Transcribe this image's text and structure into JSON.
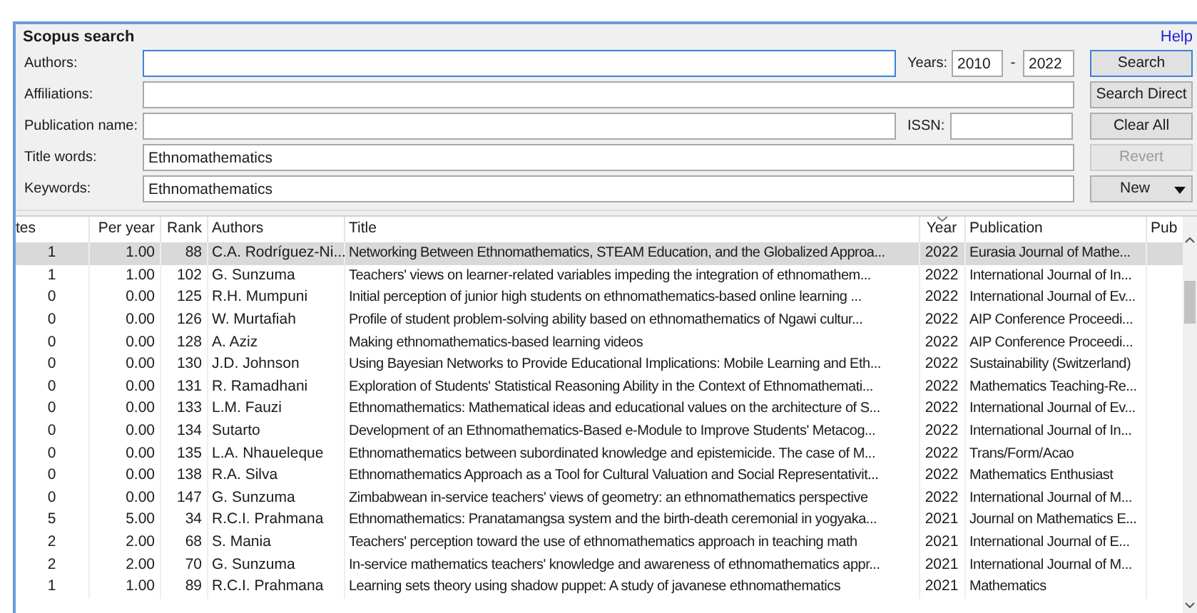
{
  "panel": {
    "title": "Scopus search",
    "help_link": "Help"
  },
  "form": {
    "authors": {
      "label": "Authors:",
      "focused": true
    },
    "years": {
      "label": "Years:",
      "from": "2010",
      "separator": "-",
      "to": "2022"
    },
    "affiliations": {
      "label": "Affiliations:"
    },
    "publication_name": {
      "label": "Publication name:"
    },
    "issn": {
      "label": "ISSN:"
    },
    "title_words": {
      "label": "Title words:",
      "value": "Ethnomathematics"
    },
    "keywords": {
      "label": "Keywords:",
      "value": "Ethnomathematics"
    }
  },
  "buttons": [
    {
      "label": "Search",
      "default": true,
      "disabled": false,
      "dropdown": false
    },
    {
      "label": "Search Direct",
      "default": false,
      "disabled": false,
      "dropdown": false
    },
    {
      "label": "Clear All",
      "default": false,
      "disabled": false,
      "dropdown": false
    },
    {
      "label": "Revert",
      "default": false,
      "disabled": true,
      "dropdown": false
    },
    {
      "label": "New",
      "default": false,
      "disabled": false,
      "dropdown": true
    }
  ],
  "table": {
    "columns": [
      {
        "label": "tes",
        "sorted": false
      },
      {
        "label": "Per year",
        "sorted": false
      },
      {
        "label": "Rank",
        "sorted": false
      },
      {
        "label": "Authors",
        "sorted": false
      },
      {
        "label": "Title",
        "sorted": false
      },
      {
        "label": "Year",
        "sorted": true
      },
      {
        "label": "Publication",
        "sorted": false
      },
      {
        "label": "Pub",
        "sorted": false
      }
    ],
    "rows": [
      {
        "selected": true,
        "cells": [
          "1",
          "1.00",
          "88",
          "C.A. Rodríguez-Ni...",
          "Networking Between Ethnomathematics, STEAM Education, and the Globalized Approa...",
          "2022",
          "Eurasia Journal of Mathe..."
        ]
      },
      {
        "selected": false,
        "cells": [
          "1",
          "1.00",
          "102",
          "G. Sunzuma",
          "Teachers' views on learner-related variables impeding the integration of ethnomathem...",
          "2022",
          "International Journal of In..."
        ]
      },
      {
        "selected": false,
        "cells": [
          "0",
          "0.00",
          "125",
          "R.H. Mumpuni",
          "Initial perception of junior high students on ethnomathematics-based online learning ...",
          "2022",
          "International Journal of Ev..."
        ]
      },
      {
        "selected": false,
        "cells": [
          "0",
          "0.00",
          "126",
          "W. Murtafiah",
          "Profile of student problem-solving ability based on ethnomathematics of Ngawi cultur...",
          "2022",
          "AIP Conference Proceedi..."
        ]
      },
      {
        "selected": false,
        "cells": [
          "0",
          "0.00",
          "128",
          "A. Aziz",
          "Making ethnomathematics-based learning videos",
          "2022",
          "AIP Conference Proceedi..."
        ]
      },
      {
        "selected": false,
        "cells": [
          "0",
          "0.00",
          "130",
          "J.D. Johnson",
          "Using Bayesian Networks to Provide Educational Implications: Mobile Learning and Eth...",
          "2022",
          "Sustainability (Switzerland)"
        ]
      },
      {
        "selected": false,
        "cells": [
          "0",
          "0.00",
          "131",
          "R. Ramadhani",
          "Exploration of Students' Statistical Reasoning Ability in the Context of Ethnomathemati...",
          "2022",
          "Mathematics Teaching-Re..."
        ]
      },
      {
        "selected": false,
        "cells": [
          "0",
          "0.00",
          "133",
          "L.M. Fauzi",
          "Ethnomathematics: Mathematical ideas and educational values on the architecture of S...",
          "2022",
          "International Journal of Ev..."
        ]
      },
      {
        "selected": false,
        "cells": [
          "0",
          "0.00",
          "134",
          "Sutarto",
          "Development of an Ethnomathematics-Based e-Module to Improve Students' Metacog...",
          "2022",
          "International Journal of In..."
        ]
      },
      {
        "selected": false,
        "cells": [
          "0",
          "0.00",
          "135",
          "L.A. Nhaueleque",
          "Ethnomathematics between subordinated knowledge and epistemicide. The case of M...",
          "2022",
          "Trans/Form/Acao"
        ]
      },
      {
        "selected": false,
        "cells": [
          "0",
          "0.00",
          "138",
          "R.A. Silva",
          "Ethnomathematics Approach as a Tool for Cultural Valuation and Social Representativit...",
          "2022",
          "Mathematics Enthusiast"
        ]
      },
      {
        "selected": false,
        "cells": [
          "0",
          "0.00",
          "147",
          "G. Sunzuma",
          "Zimbabwean in-service teachers' views of geometry: an ethnomathematics perspective",
          "2022",
          "International Journal of M..."
        ]
      },
      {
        "selected": false,
        "cells": [
          "5",
          "5.00",
          "34",
          "R.C.I. Prahmana",
          "Ethnomathematics: Pranatamangsa system and the birth-death ceremonial in yogyaka...",
          "2021",
          "Journal on Mathematics E..."
        ]
      },
      {
        "selected": false,
        "cells": [
          "2",
          "2.00",
          "68",
          "S. Mania",
          "Teachers' perception toward the use of ethnomathematics approach in teaching math",
          "2021",
          "International Journal of E..."
        ]
      },
      {
        "selected": false,
        "cells": [
          "2",
          "2.00",
          "70",
          "G. Sunzuma",
          "In-service mathematics teachers' knowledge and awareness of ethnomathematics appr...",
          "2021",
          "International Journal of M..."
        ]
      },
      {
        "selected": false,
        "cells": [
          "1",
          "1.00",
          "89",
          "R.C.I. Prahmana",
          "Learning sets theory using shadow puppet: A study of javanese ethnomathematics",
          "2021",
          "Mathematics"
        ]
      }
    ]
  }
}
